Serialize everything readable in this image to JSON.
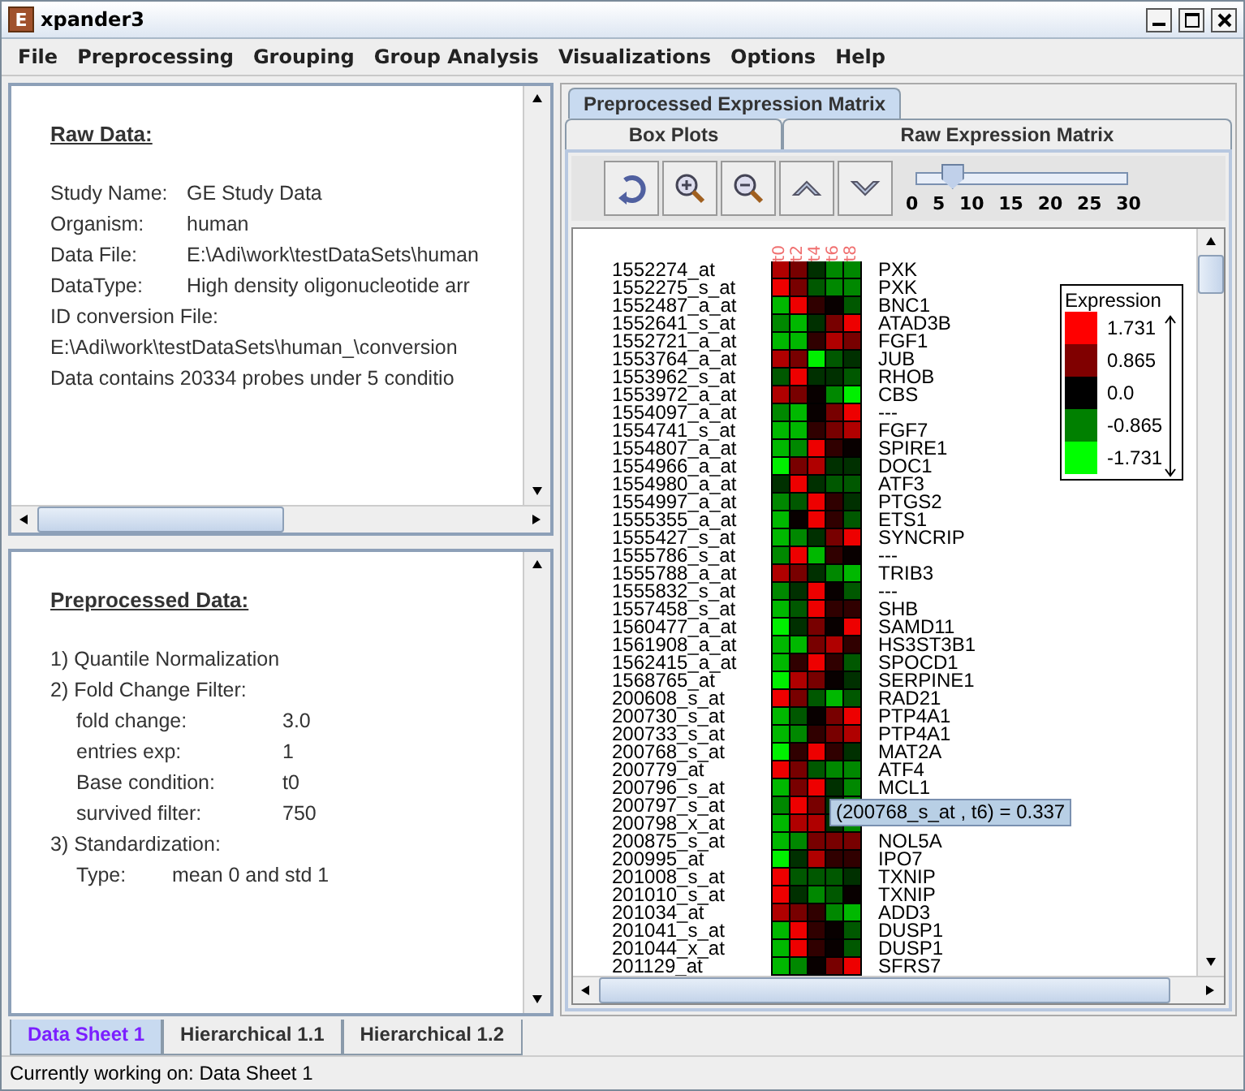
{
  "window": {
    "title": "xpander3",
    "app_letter": "E"
  },
  "menu": [
    "File",
    "Preprocessing",
    "Grouping",
    "Group Analysis",
    "Visualizations",
    "Options",
    "Help"
  ],
  "raw_panel": {
    "heading": "Raw Data:",
    "lines": [
      {
        "label": "Study Name:",
        "value": "GE Study Data"
      },
      {
        "label": "Organism:",
        "value": "human"
      },
      {
        "label": "Data File:",
        "value": "E:\\Adi\\work\\testDataSets\\human"
      },
      {
        "label": "DataType:",
        "value": "High density oligonucleotide arr"
      },
      {
        "label": "ID conversion File:"
      },
      {
        "value": "E:\\Adi\\work\\testDataSets\\human_\\conversion"
      },
      {
        "value": "Data contains 20334 probes under 5 conditio"
      }
    ]
  },
  "preprocessed_panel": {
    "heading": "Preprocessed Data:",
    "lines": [
      {
        "text": "1) Quantile Normalization"
      },
      {
        "text": "2) Fold Change Filter:"
      },
      {
        "label": "fold change:",
        "value": "3.0"
      },
      {
        "label": "entries exp:",
        "value": "1"
      },
      {
        "label": "Base condition:",
        "value": "t0"
      },
      {
        "label": "survived filter:",
        "value": "750"
      },
      {
        "text": "3) Standardization:"
      },
      {
        "label": "Type:",
        "value": "mean 0 and std 1",
        "kind": "short"
      }
    ]
  },
  "view_tabs": [
    {
      "label": "Preprocessed Expression Matrix",
      "selected": true
    },
    {
      "label": "Box Plots",
      "selected": false
    },
    {
      "label": "Raw Expression Matrix",
      "selected": false
    }
  ],
  "zoom_slider": {
    "level": 0.167,
    "ticks": [
      "0",
      "5",
      "10",
      "15",
      "20",
      "25",
      "30"
    ]
  },
  "heatmap": {
    "columns": [
      "t0",
      "t2",
      "t4",
      "t6",
      "t8"
    ],
    "rows": [
      {
        "probe": "1552274_at",
        "gene": "PXK",
        "cells": [
          {
            "color": "#b00000"
          },
          {
            "color": "#780000"
          },
          {
            "color": "#003000"
          },
          {
            "color": "#008800"
          },
          {
            "color": "#008800"
          }
        ]
      },
      {
        "probe": "1552275_s_at",
        "gene": "PXK",
        "cells": [
          {
            "color": "#ee0000"
          },
          {
            "color": "#780000"
          },
          {
            "color": "#005800"
          },
          {
            "color": "#008800"
          },
          {
            "color": "#008800"
          }
        ]
      },
      {
        "probe": "1552487_a_at",
        "gene": "BNC1",
        "cells": [
          {
            "color": "#00b800"
          },
          {
            "color": "#ee0000"
          },
          {
            "color": "#300000"
          },
          {
            "color": "#080000"
          },
          {
            "color": "#005800"
          }
        ]
      },
      {
        "probe": "1552641_s_at",
        "gene": "ATAD3B",
        "cells": [
          {
            "color": "#008800"
          },
          {
            "color": "#00b800"
          },
          {
            "color": "#003000"
          },
          {
            "color": "#780000"
          },
          {
            "color": "#ee0000"
          }
        ]
      },
      {
        "probe": "1552721_a_at",
        "gene": "FGF1",
        "cells": [
          {
            "color": "#00b800"
          },
          {
            "color": "#00b800"
          },
          {
            "color": "#300000"
          },
          {
            "color": "#b00000"
          },
          {
            "color": "#780000"
          }
        ]
      },
      {
        "probe": "1553764_a_at",
        "gene": "JUB",
        "cells": [
          {
            "color": "#b00000"
          },
          {
            "color": "#780000"
          },
          {
            "color": "#00f000"
          },
          {
            "color": "#005800"
          },
          {
            "color": "#003000"
          }
        ]
      },
      {
        "probe": "1553962_s_at",
        "gene": "RHOB",
        "cells": [
          {
            "color": "#005800"
          },
          {
            "color": "#ee0000"
          },
          {
            "color": "#003000"
          },
          {
            "color": "#003000"
          },
          {
            "color": "#005800"
          }
        ]
      },
      {
        "probe": "1553972_a_at",
        "gene": "CBS",
        "cells": [
          {
            "color": "#b00000"
          },
          {
            "color": "#780000"
          },
          {
            "color": "#080000"
          },
          {
            "color": "#008800"
          },
          {
            "color": "#00f000"
          }
        ]
      },
      {
        "probe": "1554097_a_at",
        "gene": "---",
        "cells": [
          {
            "color": "#008800"
          },
          {
            "color": "#00b800"
          },
          {
            "color": "#080000"
          },
          {
            "color": "#780000"
          },
          {
            "color": "#ee0000"
          }
        ]
      },
      {
        "probe": "1554741_s_at",
        "gene": "FGF7",
        "cells": [
          {
            "color": "#00b800"
          },
          {
            "color": "#00b800"
          },
          {
            "color": "#300000"
          },
          {
            "color": "#780000"
          },
          {
            "color": "#b00000"
          }
        ]
      },
      {
        "probe": "1554807_a_at",
        "gene": "SPIRE1",
        "cells": [
          {
            "color": "#00b800"
          },
          {
            "color": "#008800"
          },
          {
            "color": "#ee0000"
          },
          {
            "color": "#300000"
          },
          {
            "color": "#080000"
          }
        ]
      },
      {
        "probe": "1554966_a_at",
        "gene": "DOC1",
        "cells": [
          {
            "color": "#00f000"
          },
          {
            "color": "#780000"
          },
          {
            "color": "#b00000"
          },
          {
            "color": "#003000"
          },
          {
            "color": "#003000"
          }
        ]
      },
      {
        "probe": "1554980_a_at",
        "gene": "ATF3",
        "cells": [
          {
            "color": "#003000"
          },
          {
            "color": "#ee0000"
          },
          {
            "color": "#003000"
          },
          {
            "color": "#005800"
          },
          {
            "color": "#005800"
          }
        ]
      },
      {
        "probe": "1554997_a_at",
        "gene": "PTGS2",
        "cells": [
          {
            "color": "#008800"
          },
          {
            "color": "#005800"
          },
          {
            "color": "#ee0000"
          },
          {
            "color": "#300000"
          },
          {
            "color": "#003000"
          }
        ]
      },
      {
        "probe": "1555355_a_at",
        "gene": "ETS1",
        "cells": [
          {
            "color": "#00b800"
          },
          {
            "color": "#080000"
          },
          {
            "color": "#ee0000"
          },
          {
            "color": "#300000"
          },
          {
            "color": "#005800"
          }
        ]
      },
      {
        "probe": "1555427_s_at",
        "gene": "SYNCRIP",
        "cells": [
          {
            "color": "#00b800"
          },
          {
            "color": "#008800"
          },
          {
            "color": "#003000"
          },
          {
            "color": "#780000"
          },
          {
            "color": "#ee0000"
          }
        ]
      },
      {
        "probe": "1555786_s_at",
        "gene": "---",
        "cells": [
          {
            "color": "#008800"
          },
          {
            "color": "#ee0000"
          },
          {
            "color": "#00b800"
          },
          {
            "color": "#300000"
          },
          {
            "color": "#080000"
          }
        ]
      },
      {
        "probe": "1555788_a_at",
        "gene": "TRIB3",
        "cells": [
          {
            "color": "#b00000"
          },
          {
            "color": "#780000"
          },
          {
            "color": "#003000"
          },
          {
            "color": "#008800"
          },
          {
            "color": "#00b800"
          }
        ]
      },
      {
        "probe": "1555832_s_at",
        "gene": "---",
        "cells": [
          {
            "color": "#008800"
          },
          {
            "color": "#003000"
          },
          {
            "color": "#ee0000"
          },
          {
            "color": "#080000"
          },
          {
            "color": "#005800"
          }
        ]
      },
      {
        "probe": "1557458_s_at",
        "gene": "SHB",
        "cells": [
          {
            "color": "#00b800"
          },
          {
            "color": "#005800"
          },
          {
            "color": "#ee0000"
          },
          {
            "color": "#300000"
          },
          {
            "color": "#300000"
          }
        ]
      },
      {
        "probe": "1560477_a_at",
        "gene": "SAMD11",
        "cells": [
          {
            "color": "#00f000"
          },
          {
            "color": "#003000"
          },
          {
            "color": "#780000"
          },
          {
            "color": "#080000"
          },
          {
            "color": "#ee0000"
          }
        ]
      },
      {
        "probe": "1561908_a_at",
        "gene": "HS3ST3B1",
        "cells": [
          {
            "color": "#00b800"
          },
          {
            "color": "#00b800"
          },
          {
            "color": "#780000"
          },
          {
            "color": "#b00000"
          },
          {
            "color": "#300000"
          }
        ]
      },
      {
        "probe": "1562415_a_at",
        "gene": "SPOCD1",
        "cells": [
          {
            "color": "#00b800"
          },
          {
            "color": "#300000"
          },
          {
            "color": "#ee0000"
          },
          {
            "color": "#300000"
          },
          {
            "color": "#005800"
          }
        ]
      },
      {
        "probe": "1568765_at",
        "gene": "SERPINE1",
        "cells": [
          {
            "color": "#00f000"
          },
          {
            "color": "#b00000"
          },
          {
            "color": "#780000"
          },
          {
            "color": "#080000"
          },
          {
            "color": "#003000"
          }
        ]
      },
      {
        "probe": "200608_s_at",
        "gene": "RAD21",
        "cells": [
          {
            "color": "#ee0000"
          },
          {
            "color": "#780000"
          },
          {
            "color": "#005800"
          },
          {
            "color": "#00b800"
          },
          {
            "color": "#005800"
          }
        ]
      },
      {
        "probe": "200730_s_at",
        "gene": "PTP4A1",
        "cells": [
          {
            "color": "#00b800"
          },
          {
            "color": "#005800"
          },
          {
            "color": "#080000"
          },
          {
            "color": "#780000"
          },
          {
            "color": "#ee0000"
          }
        ]
      },
      {
        "probe": "200733_s_at",
        "gene": "PTP4A1",
        "cells": [
          {
            "color": "#00b800"
          },
          {
            "color": "#008800"
          },
          {
            "color": "#300000"
          },
          {
            "color": "#780000"
          },
          {
            "color": "#b00000"
          }
        ]
      },
      {
        "probe": "200768_s_at",
        "gene": "MAT2A",
        "cells": [
          {
            "color": "#00f000"
          },
          {
            "color": "#300000"
          },
          {
            "color": "#ee0000"
          },
          {
            "color": "#300000"
          },
          {
            "color": "#003000"
          }
        ]
      },
      {
        "probe": "200779_at",
        "gene": "ATF4",
        "cells": [
          {
            "color": "#ee0000"
          },
          {
            "color": "#780000"
          },
          {
            "color": "#005800"
          },
          {
            "color": "#008800"
          },
          {
            "color": "#008800"
          }
        ]
      },
      {
        "probe": "200796_s_at",
        "gene": "MCL1",
        "cells": [
          {
            "color": "#00b800"
          },
          {
            "color": "#780000"
          },
          {
            "color": "#ee0000"
          },
          {
            "color": "#003000"
          },
          {
            "color": "#008800"
          }
        ]
      },
      {
        "probe": "200797_s_at",
        "cells": [
          {
            "color": "#008800"
          },
          {
            "color": "#ee0000"
          },
          {
            "color": "#780000"
          },
          {
            "color": "#003000"
          },
          {
            "color": "#008800"
          }
        ]
      },
      {
        "probe": "200798_x_at",
        "cells": [
          {
            "color": "#00b800"
          },
          {
            "color": "#b00000"
          },
          {
            "color": "#b00000"
          },
          {
            "color": "#003000"
          },
          {
            "color": "#008800"
          }
        ]
      },
      {
        "probe": "200875_s_at",
        "gene": "NOL5A",
        "cells": [
          {
            "color": "#00b800"
          },
          {
            "color": "#008800"
          },
          {
            "color": "#780000"
          },
          {
            "color": "#780000"
          },
          {
            "color": "#780000"
          }
        ]
      },
      {
        "probe": "200995_at",
        "gene": "IPO7",
        "cells": [
          {
            "color": "#00f000"
          },
          {
            "color": "#003000"
          },
          {
            "color": "#b00000"
          },
          {
            "color": "#300000"
          },
          {
            "color": "#300000"
          }
        ]
      },
      {
        "probe": "201008_s_at",
        "gene": "TXNIP",
        "cells": [
          {
            "color": "#ee0000"
          },
          {
            "color": "#005800"
          },
          {
            "color": "#005800"
          },
          {
            "color": "#005800"
          },
          {
            "color": "#003000"
          }
        ]
      },
      {
        "probe": "201010_s_at",
        "gene": "TXNIP",
        "cells": [
          {
            "color": "#ee0000"
          },
          {
            "color": "#003000"
          },
          {
            "color": "#008800"
          },
          {
            "color": "#005800"
          },
          {
            "color": "#080000"
          }
        ]
      },
      {
        "probe": "201034_at",
        "gene": "ADD3",
        "cells": [
          {
            "color": "#b00000"
          },
          {
            "color": "#780000"
          },
          {
            "color": "#300000"
          },
          {
            "color": "#008800"
          },
          {
            "color": "#00b800"
          }
        ]
      },
      {
        "probe": "201041_s_at",
        "gene": "DUSP1",
        "cells": [
          {
            "color": "#00b800"
          },
          {
            "color": "#ee0000"
          },
          {
            "color": "#300000"
          },
          {
            "color": "#080000"
          },
          {
            "color": "#005800"
          }
        ]
      },
      {
        "probe": "201044_x_at",
        "gene": "DUSP1",
        "cells": [
          {
            "color": "#00b800"
          },
          {
            "color": "#ee0000"
          },
          {
            "color": "#300000"
          },
          {
            "color": "#080000"
          },
          {
            "color": "#005800"
          }
        ]
      },
      {
        "probe": "201129_at",
        "gene": "SFRS7",
        "cells": [
          {
            "color": "#00b800"
          },
          {
            "color": "#008800"
          },
          {
            "color": "#080000"
          },
          {
            "color": "#780000"
          },
          {
            "color": "#ee0000"
          }
        ]
      }
    ]
  },
  "legend": {
    "title": "Expression",
    "entries": [
      {
        "value": "1.731",
        "color": "#ff0000"
      },
      {
        "value": "0.865",
        "color": "#800000"
      },
      {
        "value": "0.0",
        "color": "#000000"
      },
      {
        "value": "-0.865",
        "color": "#008000"
      },
      {
        "value": "-1.731",
        "color": "#00ff00"
      }
    ]
  },
  "tooltip": "(200768_s_at , t6) = 0.337",
  "sheet_tabs": [
    {
      "label": "Data Sheet 1",
      "selected": true
    },
    {
      "label": "Hierarchical 1.1",
      "selected": false
    },
    {
      "label": "Hierarchical 1.2",
      "selected": false
    }
  ],
  "status_bar": "Currently working on: Data Sheet 1"
}
